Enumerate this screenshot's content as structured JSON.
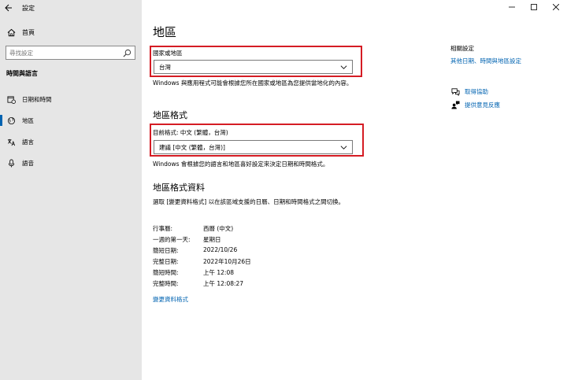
{
  "window": {
    "title": "設定"
  },
  "sidebar": {
    "home_label": "首頁",
    "search_placeholder": "尋找設定",
    "section_title": "時間與語言",
    "items": [
      {
        "label": "日期和時間",
        "icon": "calendar-clock-icon"
      },
      {
        "label": "地區",
        "icon": "globe-icon",
        "selected": true
      },
      {
        "label": "語言",
        "icon": "language-icon"
      },
      {
        "label": "語音",
        "icon": "microphone-icon"
      }
    ]
  },
  "main": {
    "title": "地區",
    "country_label": "國家或地區",
    "country_value": "台灣",
    "country_desc": "Windows 與應用程式可能會根據您所在國家或地區為您提供當地化的內容。",
    "format_heading": "地區格式",
    "current_format_label": "目前格式: 中文 (繁體，台灣)",
    "format_value": "建議 [中文 (繁體，台灣)]",
    "format_desc": "Windows 會根據您的語言和地區喜好設定來決定日期和時間格式。",
    "data_heading": "地區格式資料",
    "data_desc": "選取 [變更資料格式] 以在該區域支援的日曆、日期和時間格式之間切換。",
    "format_rows": [
      {
        "key": "行事曆:",
        "value": "西曆 (中文)"
      },
      {
        "key": "一週的第一天:",
        "value": "星期日"
      },
      {
        "key": "簡短日期:",
        "value": "2022/10/26"
      },
      {
        "key": "完整日期:",
        "value": "2022年10月26日"
      },
      {
        "key": "簡短時間:",
        "value": "上午 12:08"
      },
      {
        "key": "完整時間:",
        "value": "上午 12:08:27"
      }
    ],
    "change_format_link": "變更資料格式"
  },
  "related": {
    "title": "相關設定",
    "link": "其他日期、時間與地區設定",
    "help_link": "取得協助",
    "feedback_link": "提供意見反應"
  },
  "colors": {
    "accent": "#0063b1",
    "highlight": "#d51c24",
    "sidebar_bg": "#e6e6e6"
  }
}
